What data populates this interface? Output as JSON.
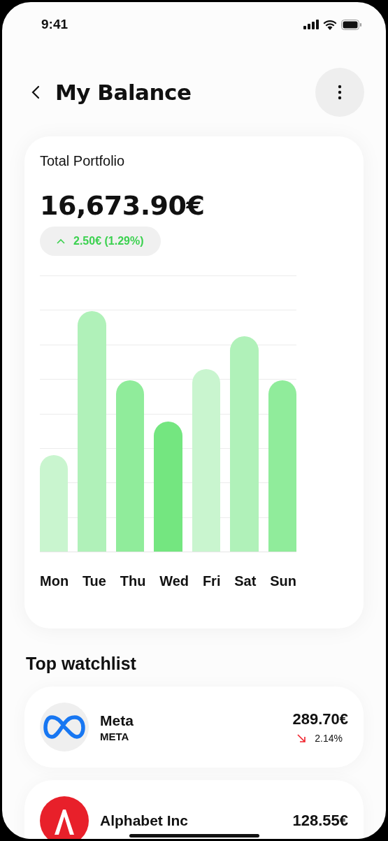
{
  "status_bar": {
    "time": "9:41"
  },
  "header": {
    "title": "My Balance"
  },
  "portfolio": {
    "label": "Total Portfolio",
    "value": "16,673.90€",
    "change": {
      "kind": "up",
      "text": "2.50€ (1.29%)"
    }
  },
  "chart": {
    "days": [
      {
        "label": "Mon",
        "color": "#c9f5cf"
      },
      {
        "label": "Tue",
        "color": "#b0f1b9"
      },
      {
        "label": "Thu",
        "color": "#90ec9b"
      },
      {
        "label": "Wed",
        "color": "#74e680"
      },
      {
        "label": "Fri",
        "color": "#c9f5cf"
      },
      {
        "label": "Sat",
        "color": "#b0f1b9"
      },
      {
        "label": "Sun",
        "color": "#90ec9b"
      }
    ]
  },
  "watchlist": {
    "title": "Top watchlist",
    "items": [
      {
        "kind": "meta",
        "name": "Meta",
        "ticker": "META",
        "price": "289.70€",
        "change": {
          "kind": "down",
          "text": "2.14%"
        }
      },
      {
        "kind": "alphabet",
        "name": "Alphabet Inc",
        "price": "128.55€"
      }
    ]
  }
}
